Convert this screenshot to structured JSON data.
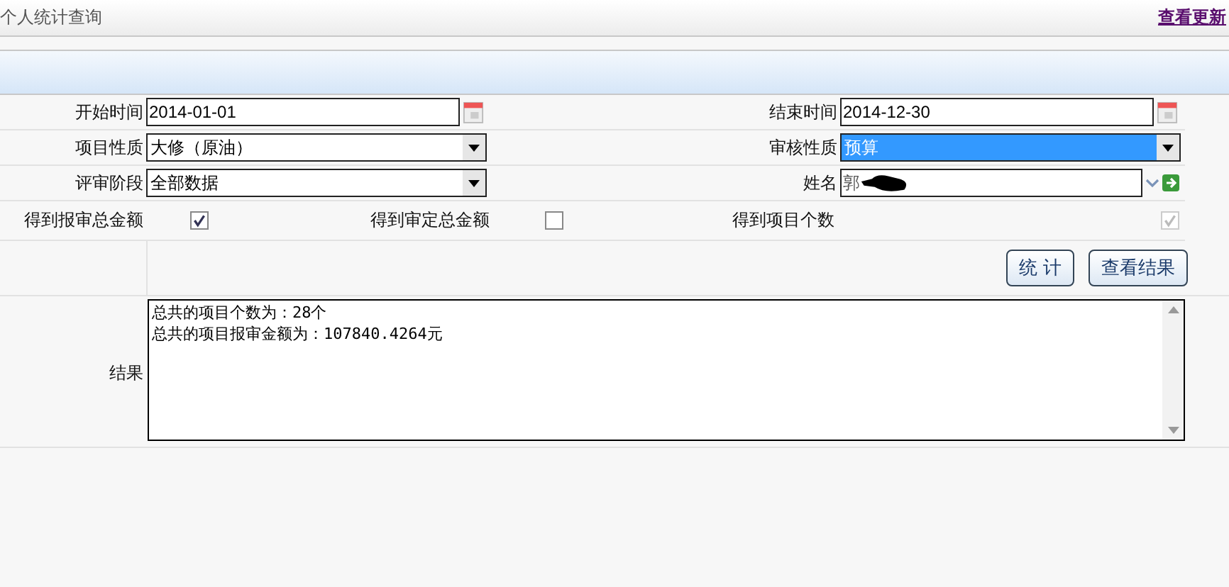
{
  "header": {
    "title": "个人统计查询",
    "link": "查看更新"
  },
  "fields": [
    {
      "label": "开始时间",
      "kind": "date",
      "value": "2014-01-01"
    },
    {
      "label": "结束时间",
      "kind": "date",
      "value": "2014-12-30"
    },
    {
      "label": "项目性质",
      "kind": "select",
      "value": "大修（原油）",
      "selected": false
    },
    {
      "label": "审核性质",
      "kind": "select",
      "value": "预算",
      "selected": true
    },
    {
      "label": "评审阶段",
      "kind": "select",
      "value": "全部数据",
      "selected": false
    },
    {
      "label": "姓名",
      "kind": "combo",
      "value": "郭"
    }
  ],
  "checks": [
    {
      "label": "得到报审总金额",
      "checked": true,
      "disabled": false
    },
    {
      "label": "得到审定总金额",
      "checked": false,
      "disabled": false
    },
    {
      "label": "得到项目个数",
      "checked": true,
      "disabled": true
    }
  ],
  "buttons": [
    "统 计",
    "查看结果"
  ],
  "result": {
    "label": "结果",
    "lines": [
      "总共的项目个数为：28个",
      "总共的项目报审金额为：107840.4264元"
    ]
  }
}
